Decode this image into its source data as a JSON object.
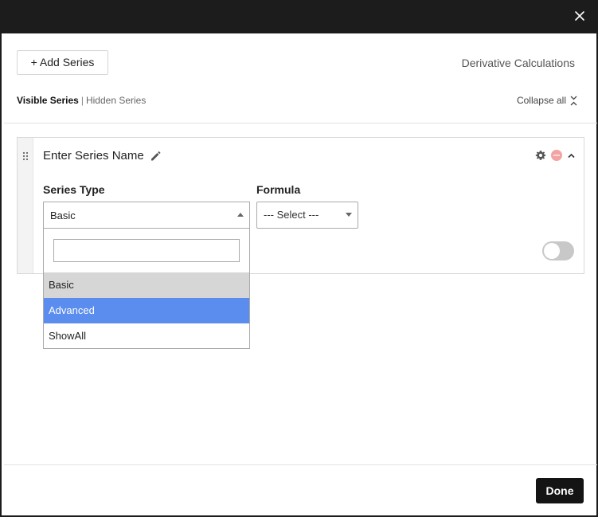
{
  "header": {
    "close_icon": "close-icon"
  },
  "toolbar": {
    "add_series_label": "+ Add Series",
    "derivative_label": "Derivative Calculations"
  },
  "series_tabs": {
    "visible_label": "Visible Series",
    "separator": "|",
    "hidden_label": "Hidden Series",
    "collapse_all_label": "Collapse all"
  },
  "series_card": {
    "name": "Enter Series Name",
    "series_type_label": "Series Type",
    "series_type_value": "Basic",
    "formula_label": "Formula",
    "formula_value": "--- Select ---",
    "toggle_on": false,
    "remove_color": "#f3a3a3"
  },
  "dropdown": {
    "search_value": "",
    "options": [
      "Basic",
      "Advanced",
      "ShowAll"
    ],
    "selected": "Basic",
    "highlighted": "Advanced",
    "highlight_color": "#5a8ded"
  },
  "footer": {
    "done_label": "Done"
  }
}
